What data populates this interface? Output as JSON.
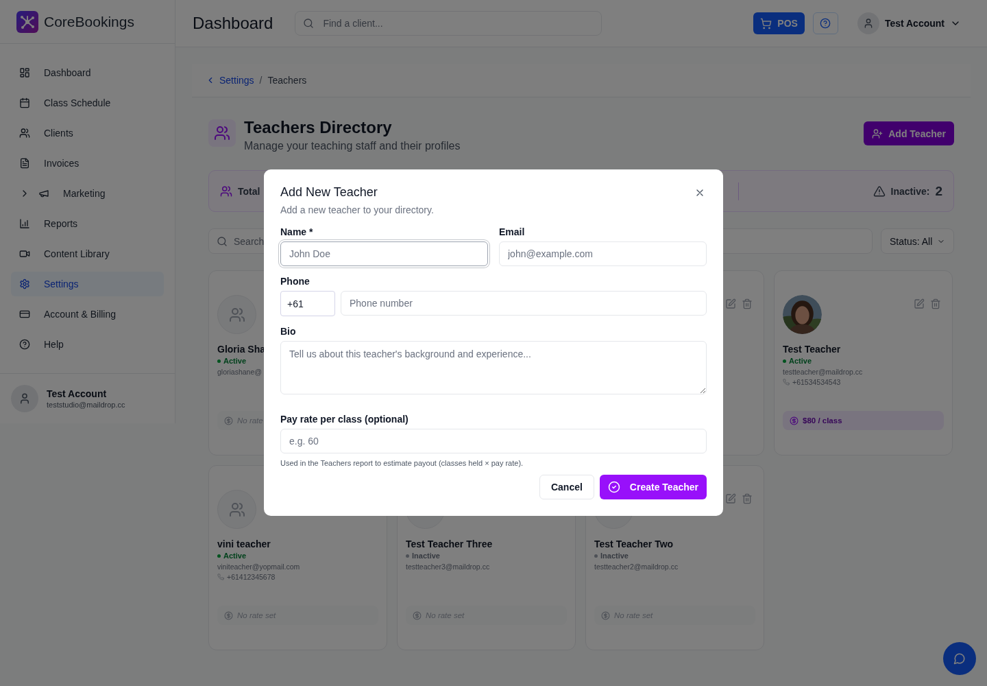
{
  "sidebar": {
    "brand": "CoreBookings",
    "items": [
      {
        "label": "Dashboard",
        "kind": "link",
        "selected": false
      },
      {
        "label": "Class Schedule",
        "kind": "link",
        "selected": false
      },
      {
        "label": "Clients",
        "kind": "link",
        "selected": false
      },
      {
        "label": "Invoices",
        "kind": "link",
        "selected": false
      },
      {
        "label": "Marketing",
        "kind": "group",
        "selected": false
      },
      {
        "label": "Reports",
        "kind": "link",
        "selected": false
      },
      {
        "label": "Content Library",
        "kind": "link",
        "selected": false
      },
      {
        "label": "Settings",
        "kind": "link",
        "selected": true
      },
      {
        "label": "Account & Billing",
        "kind": "link",
        "selected": false
      },
      {
        "label": "Help",
        "kind": "link",
        "selected": false
      }
    ],
    "account": {
      "name": "Test Account",
      "email": "teststudio@maildrop.cc"
    }
  },
  "topbar": {
    "title": "Dashboard",
    "search": {
      "placeholder": "Find a client..."
    },
    "pos_label": "POS",
    "account_name": "Test Account"
  },
  "breadcrumb": {
    "separator": "/",
    "items": [
      {
        "label": "Settings",
        "link": true
      },
      {
        "label": "Teachers",
        "link": false
      }
    ]
  },
  "page_header": {
    "title": "Teachers Directory",
    "subtitle": "Manage your teaching staff and their profiles",
    "add_button": "Add Teacher"
  },
  "stats": {
    "total_label": "Total",
    "inactive_label": "Inactive:",
    "inactive_count": "2"
  },
  "filters": {
    "search": {
      "placeholder": "Search"
    },
    "status_label": "Status: All"
  },
  "cards": [
    {
      "avatar": {
        "kind": "icon"
      },
      "name": "Gloria Sha",
      "active": true,
      "status": "Active",
      "email": "gloriashane@",
      "rate": {
        "text": "No rate",
        "set": false
      }
    },
    {
      "actions": true
    },
    {
      "name": "Test Teacher",
      "active": true,
      "status": "Active",
      "email": "testteacher@maildrop.cc",
      "phone": "+61534534543",
      "rate": {
        "text": "$80 / class",
        "set": true
      },
      "actions": true
    },
    {
      "avatar": {
        "kind": "icon"
      },
      "name": "vini teacher",
      "active": true,
      "status": "Active",
      "email": "viniteacher@yopmail.com",
      "phone": "+61412345678",
      "rate": {
        "text": "No rate set",
        "set": false
      }
    },
    {
      "avatar": {
        "kind": "circle"
      },
      "name": "Test Teacher Three",
      "active": false,
      "status": "Inactive",
      "email": "testteacher3@maildrop.cc",
      "rate": {
        "text": "No rate set",
        "set": false
      }
    },
    {
      "avatar": {
        "kind": "circle"
      },
      "name": "Test Teacher Two",
      "active": false,
      "status": "Inactive",
      "email": "testteacher2@maildrop.cc",
      "rate": {
        "text": "No rate set",
        "set": false
      },
      "actions": true
    }
  ],
  "modal": {
    "title": "Add New Teacher",
    "subtitle": "Add a new teacher to your directory.",
    "name_field": {
      "label": "Name *",
      "placeholder": "John Doe",
      "focused": true
    },
    "email_field": {
      "label": "Email",
      "placeholder": "john@example.com",
      "focused": false
    },
    "phone_field": {
      "label": "Phone",
      "prefix": "+61",
      "placeholder": "Phone number",
      "focused": false
    },
    "bio_field": {
      "label": "Bio",
      "placeholder": "Tell us about this teacher's background and experience...",
      "focused": false
    },
    "pay_field": {
      "label": "Pay rate per class (optional)",
      "placeholder": "e.g. 60",
      "hint": "Used in the Teachers report to estimate payout (classes held × pay rate).",
      "focused": false
    },
    "cancel_button": "Cancel",
    "create_button": "Create Teacher"
  }
}
